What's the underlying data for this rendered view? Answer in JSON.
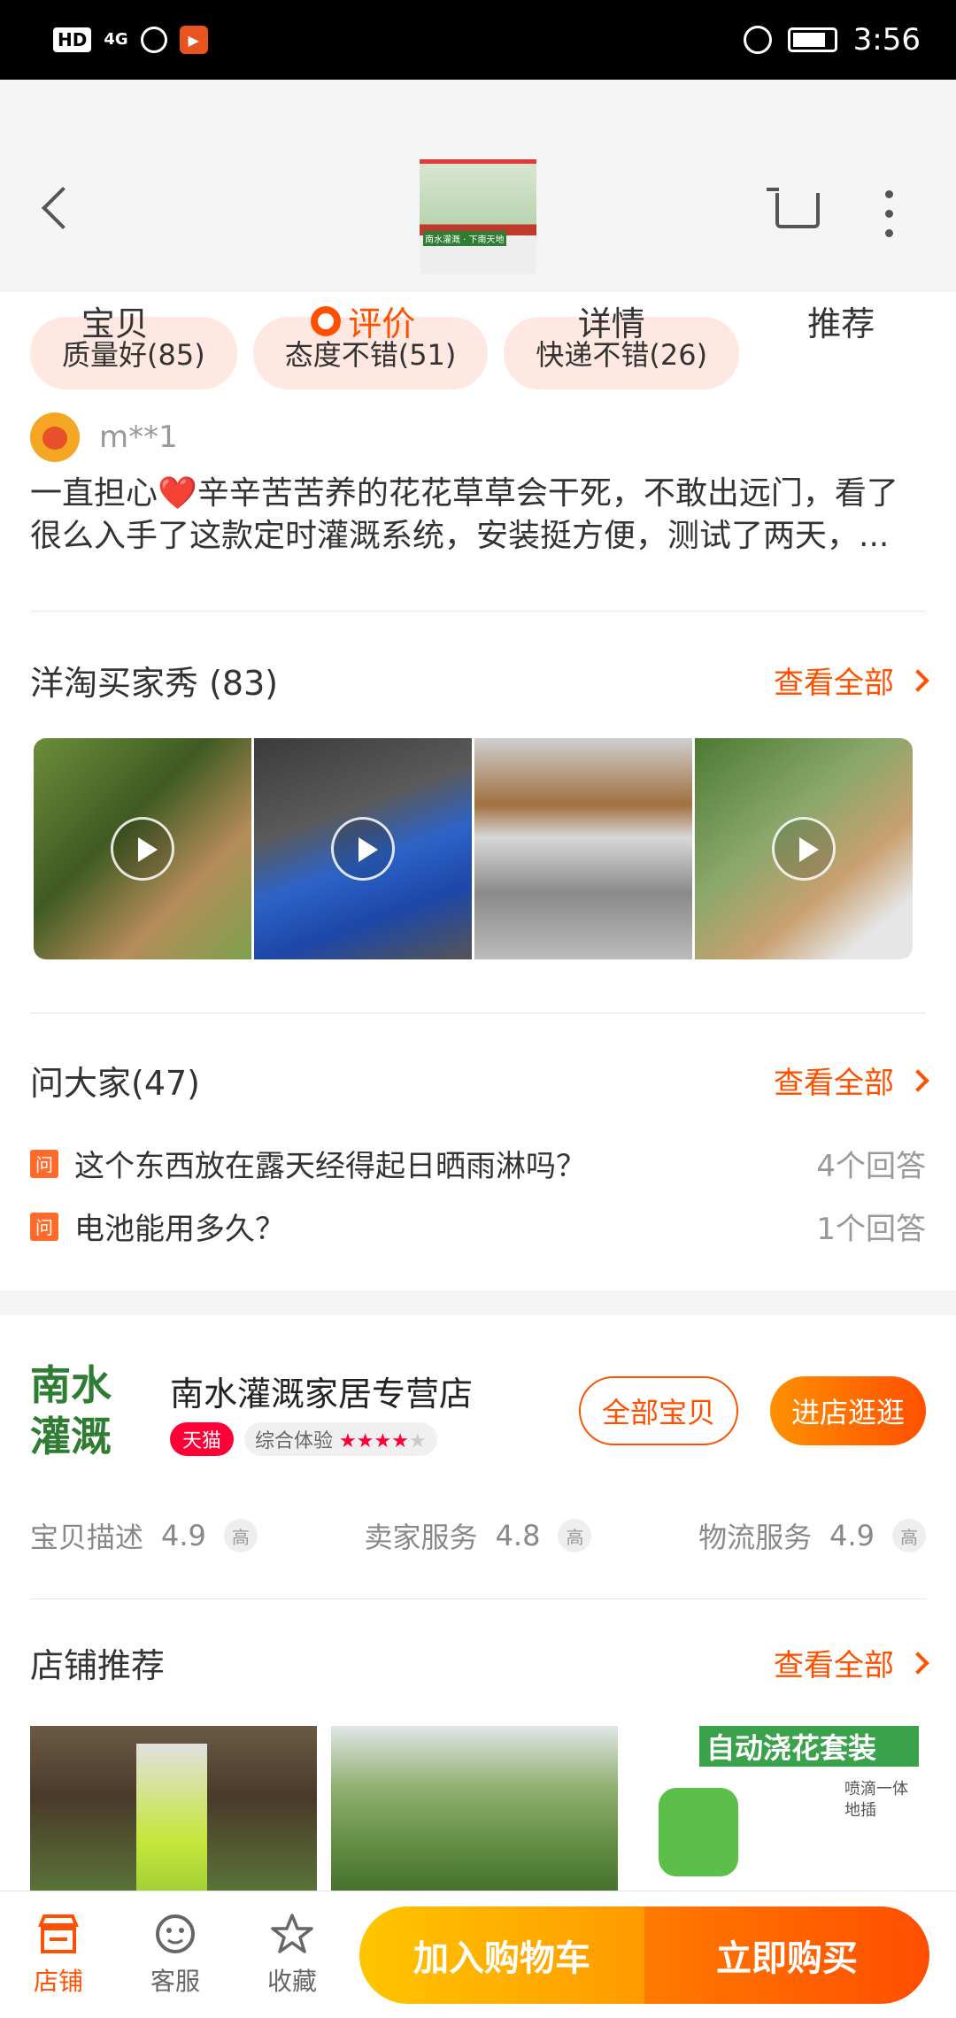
{
  "status_bar": {
    "hd": "HD",
    "signal": "4G",
    "time": "3:56"
  },
  "header": {
    "thumbnail_text": "南水灌溉 · 下南天地",
    "tabs": [
      {
        "label": "宝贝",
        "active": false
      },
      {
        "label": "评价",
        "active": true
      },
      {
        "label": "详情",
        "active": false
      },
      {
        "label": "推荐",
        "active": false
      }
    ]
  },
  "review_tags": [
    "质量好(85)",
    "态度不错(51)",
    "快递不错(26)"
  ],
  "review": {
    "username": "m**1",
    "text": "一直担心❤️辛辛苦苦养的花花草草会干死，不敢出远门，看了很么入手了这款定时灌溉系统，安装挺方便，测试了两天，..."
  },
  "buyer_show": {
    "title": "洋淘买家秀 (83)",
    "see_all": "查看全部"
  },
  "qa": {
    "title": "问大家(47)",
    "see_all": "查看全部",
    "icon_label": "问",
    "questions": [
      {
        "q": "这个东西放在露天经得起日晒雨淋吗？",
        "answers": "4个回答"
      },
      {
        "q": "电池能用多久？",
        "answers": "1个回答"
      }
    ]
  },
  "store": {
    "logo_line1": "南水",
    "logo_line2": "灌溉",
    "name": "南水灌溉家居专营店",
    "tmall_badge": "天猫",
    "experience_label": "综合体验",
    "experience_stars": "★★★★",
    "experience_empty": "★",
    "all_items_button": "全部宝贝",
    "enter_store_button": "进店逛逛",
    "scores": [
      {
        "label": "宝贝描述",
        "value": "4.9",
        "level": "高"
      },
      {
        "label": "卖家服务",
        "value": "4.8",
        "level": "高"
      },
      {
        "label": "物流服务",
        "value": "4.9",
        "level": "高"
      }
    ]
  },
  "store_recs": {
    "title": "店铺推荐",
    "see_all": "查看全部",
    "item3_banner": "自动浇花套装",
    "item3_small": "喷滴一体\n地插"
  },
  "bottom_bar": {
    "store_label": "店铺",
    "service_label": "客服",
    "favorite_label": "收藏",
    "add_to_cart": "加入购物车",
    "buy_now": "立即购买"
  },
  "colors": {
    "accent": "#ff5000",
    "tag_bg": "#ffe8e2",
    "tmall": "#ff0036"
  }
}
